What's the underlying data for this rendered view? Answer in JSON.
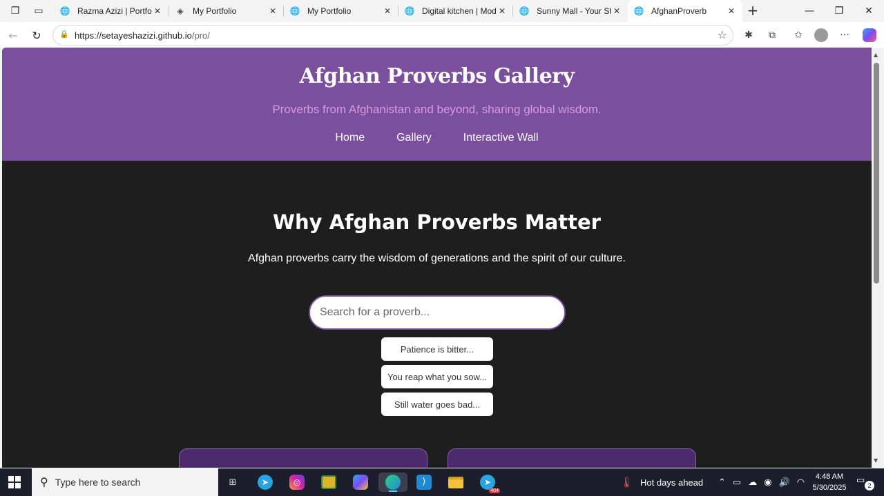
{
  "browser": {
    "tabs": [
      {
        "title": "Razma Azizi | Portfolio",
        "icon": "globe-icon"
      },
      {
        "title": "My Portfolio",
        "icon": "diamond-icon"
      },
      {
        "title": "My Portfolio",
        "icon": "globe-icon"
      },
      {
        "title": "Digital kitchen | Modern",
        "icon": "globe-icon"
      },
      {
        "title": "Sunny Mall - Your Shop",
        "icon": "globe-icon"
      },
      {
        "title": "AfghanProverb",
        "icon": "globe-icon",
        "active": true
      }
    ],
    "url": "https://setayeshazizi.github.io",
    "url_path": "/pro/"
  },
  "page": {
    "title": "Afghan Proverbs Gallery",
    "subtitle": "Proverbs from Afghanistan and beyond, sharing global wisdom.",
    "nav": [
      "Home",
      "Gallery",
      "Interactive Wall"
    ],
    "section_title": "Why Afghan Proverbs Matter",
    "section_text": "Afghan proverbs carry the wisdom of generations and the spirit of our culture.",
    "search_placeholder": "Search for a proverb...",
    "suggestions": [
      "Patience is bitter...",
      "You reap what you sow...",
      "Still water goes bad..."
    ],
    "colors": {
      "hero": "#7a4f9e",
      "subtitle": "#d79be0",
      "background": "#1e1e1e",
      "card": "#4b2a6e"
    }
  },
  "taskbar": {
    "search_placeholder": "Type here to search",
    "weather": "Hot days ahead",
    "time": "4:48 AM",
    "date": "5/30/2025",
    "notification_count": "2",
    "telegram_badge": "404"
  }
}
